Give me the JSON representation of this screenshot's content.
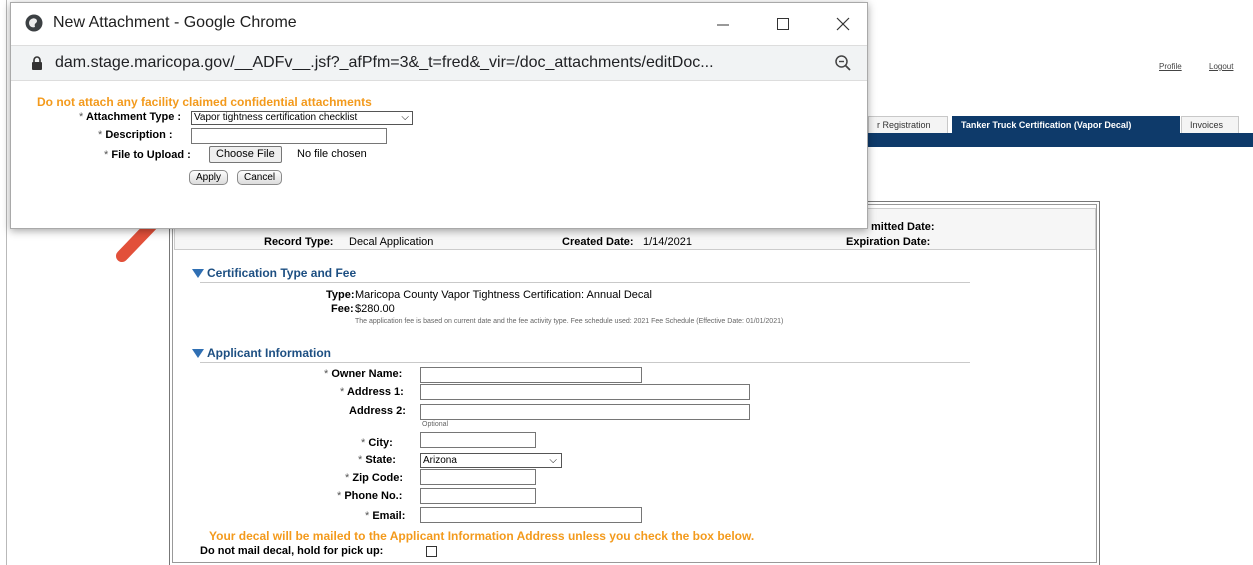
{
  "popup": {
    "window_title": "New Attachment - Google Chrome",
    "url": "dam.stage.maricopa.gov/__ADFv__.jsf?_afPfm=3&_t=fred&_vir=/doc_attachments/editDoc...",
    "warning": "Do not attach any facility claimed confidential attachments",
    "attachment_type_label": "Attachment Type :",
    "attachment_type_value": "Vapor tightness certification checklist",
    "description_label": "Description :",
    "file_label": "File to Upload :",
    "choose_file_label": "Choose File",
    "no_file_text": "No file chosen",
    "apply_label": "Apply",
    "cancel_label": "Cancel",
    "required_mark": "*"
  },
  "header": {
    "profile_label": "Profile",
    "logout_label": "Logout"
  },
  "tabs": [
    {
      "label": "r Registration"
    },
    {
      "label": "Tanker Truck Certification (Vapor Decal)"
    },
    {
      "label": "Invoices"
    }
  ],
  "summary": {
    "record_type_label": "Record Type:",
    "record_type_value": "Decal Application",
    "created_date_label": "Created Date:",
    "created_date_value": "1/14/2021",
    "submitted_date_label": "mitted Date:",
    "expiration_date_label": "Expiration Date:"
  },
  "certification": {
    "heading": "Certification Type and Fee",
    "type_label": "Type:",
    "type_value": "Maricopa County Vapor Tightness Certification: Annual Decal",
    "fee_label": "Fee:",
    "fee_value": "$280.00",
    "fee_note": "The application fee is based on current date and the fee activity type. Fee schedule used: 2021 Fee Schedule (Effective Date: 01/01/2021)"
  },
  "applicant": {
    "heading": "Applicant Information",
    "owner_label": "Owner Name:",
    "address1_label": "Address 1:",
    "address2_label": "Address 2:",
    "optional_note": "Optional",
    "city_label": "City:",
    "state_label": "State:",
    "state_value": "Arizona",
    "zip_label": "Zip Code:",
    "phone_label": "Phone No.:",
    "email_label": "Email:",
    "mail_notice": "Your decal will be mailed to the Applicant Information Address unless you check the box below.",
    "hold_label": "Do not mail decal, hold for pick up:"
  },
  "colors": {
    "accent_orange": "#f39a1c",
    "nav_blue": "#0e3a6a",
    "section_blue": "#1d4f82",
    "arrow_red": "#e2503a"
  }
}
